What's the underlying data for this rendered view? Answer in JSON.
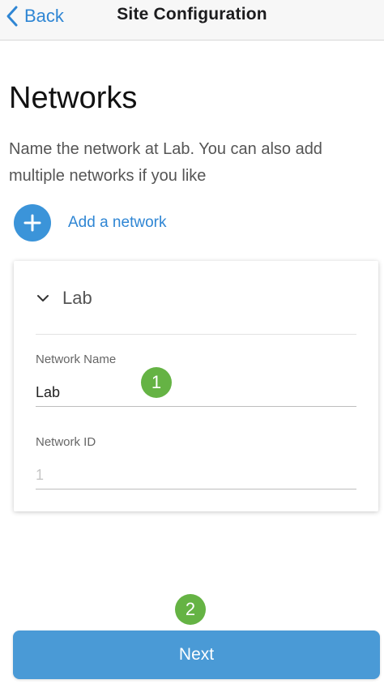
{
  "navbar": {
    "back_label": "Back",
    "title": "Site Configuration"
  },
  "page": {
    "heading": "Networks",
    "description": "Name the network at Lab. You can also add multiple networks if you like"
  },
  "add_network": {
    "label": "Add a network"
  },
  "network_card": {
    "title": "Lab",
    "name_field": {
      "label": "Network Name",
      "value": "Lab"
    },
    "id_field": {
      "label": "Network ID",
      "placeholder": "1"
    }
  },
  "annotations": {
    "step_1": "1",
    "step_2": "2"
  },
  "footer": {
    "next_label": "Next"
  },
  "colors": {
    "accent": "#3b94d9",
    "link": "#2f86d4",
    "badge": "#65b344",
    "button": "#4a9ad6"
  },
  "icons": {
    "back": "chevron-left-icon",
    "add": "plus-icon",
    "collapse": "chevron-down-icon"
  }
}
